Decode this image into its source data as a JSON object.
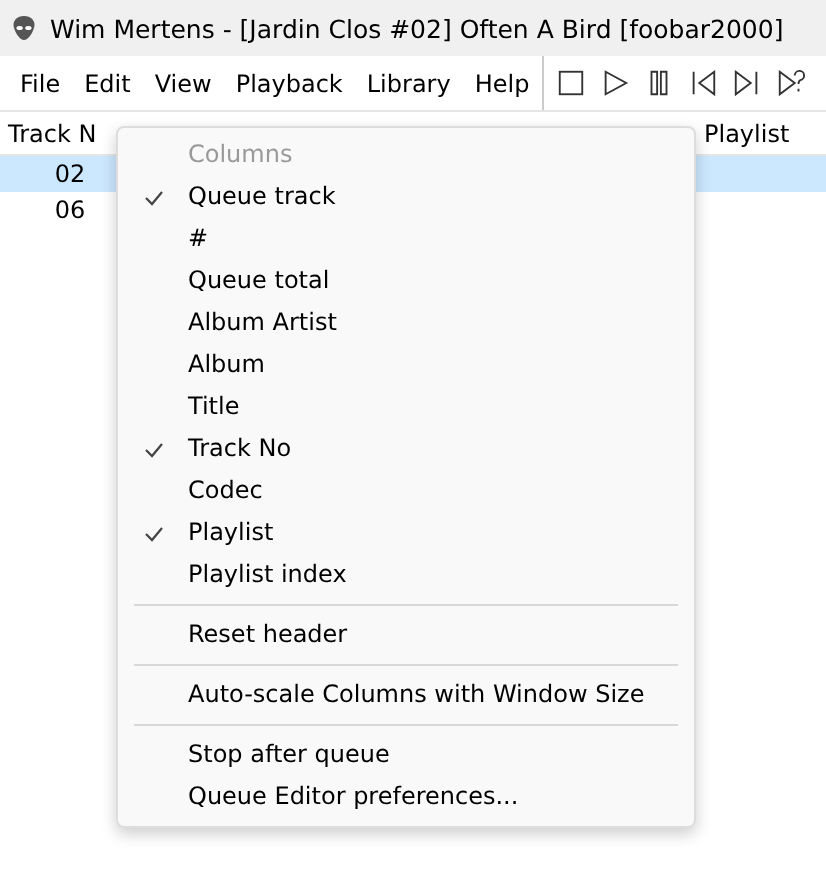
{
  "window": {
    "title": "Wim Mertens - [Jardin Clos #02] Often A Bird  [foobar2000]"
  },
  "menu_bar": [
    "File",
    "Edit",
    "View",
    "Playback",
    "Library",
    "Help"
  ],
  "toolbar": [
    {
      "kind": "stop"
    },
    {
      "kind": "play"
    },
    {
      "kind": "pause"
    },
    {
      "kind": "previous"
    },
    {
      "kind": "next"
    },
    {
      "kind": "random"
    }
  ],
  "table": {
    "columns": [
      "Track N",
      "Playlist"
    ],
    "rows": [
      {
        "track_no": "02",
        "selected": true
      },
      {
        "track_no": "06",
        "selected": false
      }
    ]
  },
  "context_menu": {
    "items": [
      {
        "kind": "heading",
        "label": "Columns"
      },
      {
        "kind": "check",
        "label": "Queue track",
        "checked": true
      },
      {
        "kind": "check",
        "label": "#",
        "checked": false
      },
      {
        "kind": "check",
        "label": "Queue total",
        "checked": false
      },
      {
        "kind": "check",
        "label": "Album Artist",
        "checked": false
      },
      {
        "kind": "check",
        "label": "Album",
        "checked": false
      },
      {
        "kind": "check",
        "label": "Title",
        "checked": false
      },
      {
        "kind": "check",
        "label": "Track No",
        "checked": true
      },
      {
        "kind": "check",
        "label": "Codec",
        "checked": false
      },
      {
        "kind": "check",
        "label": "Playlist",
        "checked": true
      },
      {
        "kind": "check",
        "label": "Playlist index",
        "checked": false
      },
      {
        "kind": "separator"
      },
      {
        "kind": "command",
        "label": "Reset header"
      },
      {
        "kind": "separator"
      },
      {
        "kind": "command",
        "label": "Auto-scale Columns with Window Size"
      },
      {
        "kind": "separator"
      },
      {
        "kind": "command",
        "label": "Stop after queue"
      },
      {
        "kind": "command",
        "label": "Queue Editor preferences..."
      }
    ]
  }
}
